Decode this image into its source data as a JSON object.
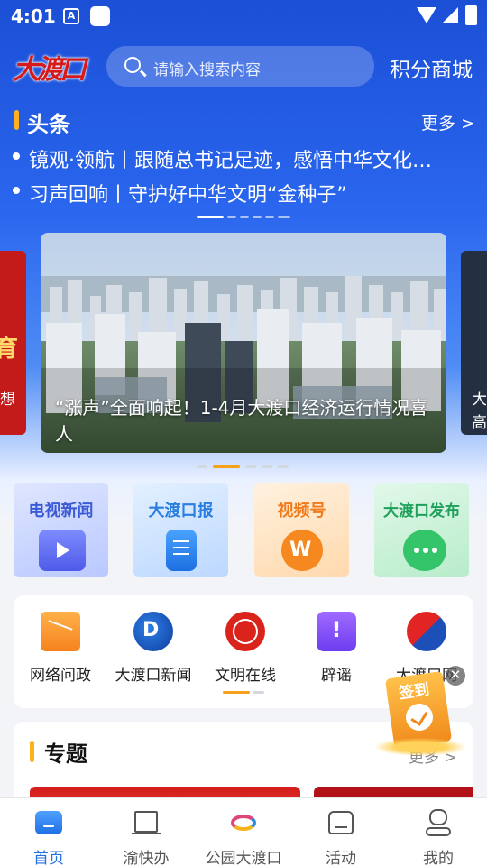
{
  "status_bar": {
    "time": "4:01",
    "notif_badge": "A"
  },
  "header": {
    "logo_text": "大渡口",
    "search_placeholder": "请输入搜索内容",
    "points_mall": "积分商城"
  },
  "headlines": {
    "title": "头条",
    "more": "更多 >",
    "items": [
      "镜观·领航丨跟随总书记足迹，感悟中华文化…",
      "习声回响丨守护好中华文明“金种子”"
    ]
  },
  "banner": {
    "caption": "“涨声”全面响起！1-4月大渡口经济运行情况喜人",
    "left_card": {
      "char": "育",
      "sub": "想"
    },
    "right_card": {
      "line1": "大",
      "line2": "高"
    }
  },
  "channels": [
    {
      "label": "电视新闻",
      "icon": "tv-play-icon",
      "color": "#3b5bd6"
    },
    {
      "label": "大渡口报",
      "icon": "newspaper-icon",
      "color": "#2a7ee0"
    },
    {
      "label": "视频号",
      "icon": "video-channel-icon",
      "color": "#f07a1a"
    },
    {
      "label": "大渡口发布",
      "icon": "wechat-icon",
      "color": "#1fa05a"
    }
  ],
  "services": [
    {
      "label": "网络问政",
      "icon": "mail-envelope-icon"
    },
    {
      "label": "大渡口新闻",
      "icon": "dadukou-news-logo-icon"
    },
    {
      "label": "文明在线",
      "icon": "civilization-logo-icon"
    },
    {
      "label": "辟谣",
      "icon": "rumor-alert-icon"
    },
    {
      "label": "大渡口网",
      "icon": "dadukou-web-logo-icon"
    }
  ],
  "topic": {
    "title": "专题",
    "more": "更多 >"
  },
  "signin": {
    "label": "签到",
    "close": "✕"
  },
  "bottom_nav": [
    {
      "label": "首页",
      "icon": "home-icon",
      "active": true
    },
    {
      "label": "渝快办",
      "icon": "building-icon",
      "active": false
    },
    {
      "label": "公园大渡口",
      "icon": "park-logo-icon",
      "active": false
    },
    {
      "label": "活动",
      "icon": "activity-icon",
      "active": false
    },
    {
      "label": "我的",
      "icon": "profile-icon",
      "active": false
    }
  ]
}
